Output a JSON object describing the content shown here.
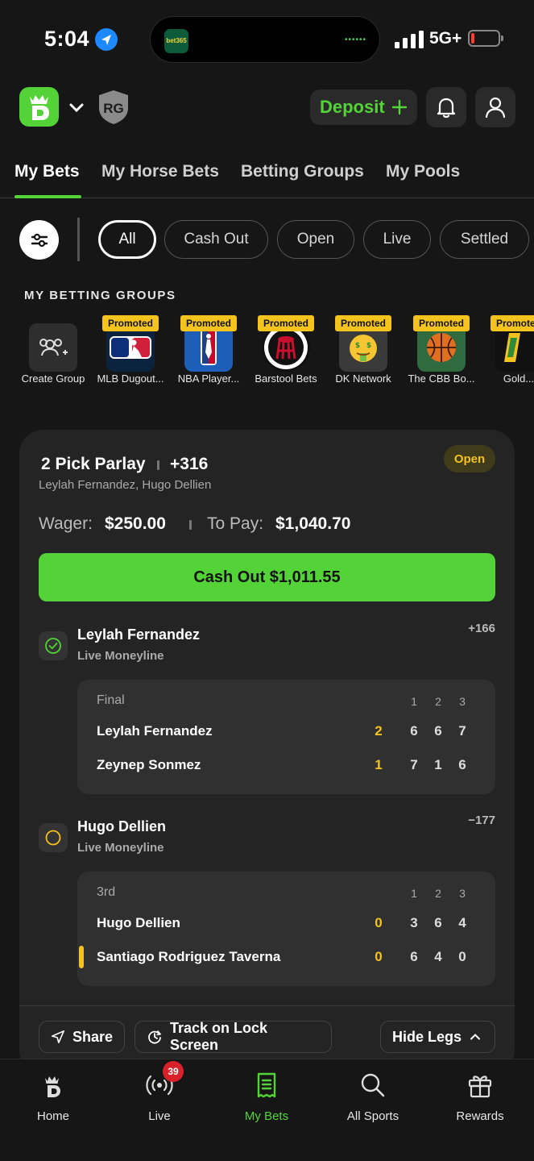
{
  "status_bar": {
    "time": "5:04",
    "network": "5G+",
    "island_app": "bet365",
    "battery_fraction": 0.12
  },
  "header": {
    "deposit_label": "Deposit",
    "rg_label": "RG"
  },
  "tabs": [
    {
      "label": "My Bets",
      "active": true
    },
    {
      "label": "My Horse Bets",
      "active": false
    },
    {
      "label": "Betting Groups",
      "active": false
    },
    {
      "label": "My Pools",
      "active": false
    }
  ],
  "filters": [
    {
      "label": "All",
      "active": true
    },
    {
      "label": "Cash Out",
      "active": false
    },
    {
      "label": "Open",
      "active": false
    },
    {
      "label": "Live",
      "active": false
    },
    {
      "label": "Settled",
      "active": false
    }
  ],
  "groups": {
    "title": "MY BETTING GROUPS",
    "promo_label": "Promoted",
    "items": [
      {
        "label": "Create Group",
        "icon": "create-group-icon",
        "promoted": false
      },
      {
        "label": "MLB Dugout...",
        "icon": "mlb-logo-icon",
        "promoted": true
      },
      {
        "label": "NBA Player...",
        "icon": "nba-logo-icon",
        "promoted": true
      },
      {
        "label": "Barstool Bets",
        "icon": "barstool-logo-icon",
        "promoted": true
      },
      {
        "label": "DK Network",
        "icon": "money-face-icon",
        "promoted": true
      },
      {
        "label": "The CBB Bo...",
        "icon": "basketball-icon",
        "promoted": true
      },
      {
        "label": "Gold...",
        "icon": "golf-logo-icon",
        "promoted": true
      }
    ]
  },
  "bet": {
    "title": "2 Pick Parlay",
    "odds": "+316",
    "subtitle": "Leylah Fernandez, Hugo Dellien",
    "status": "Open",
    "wager_label": "Wager:",
    "wager_value": "$250.00",
    "topay_label": "To Pay:",
    "topay_value": "$1,040.70",
    "cashout_label": "Cash Out $1,011.55",
    "legs": [
      {
        "selection": "Leylah Fernandez",
        "market": "Live Moneyline",
        "odds": "+166",
        "state": "won",
        "score": {
          "status": "Final",
          "headers": [
            "1",
            "2",
            "3"
          ],
          "players": [
            {
              "name": "Leylah Fernandez",
              "sets": "2",
              "games": [
                "6",
                "6",
                "7"
              ]
            },
            {
              "name": "Zeynep Sonmez",
              "sets": "1",
              "games": [
                "7",
                "1",
                "6"
              ]
            }
          ]
        }
      },
      {
        "selection": "Hugo Dellien",
        "market": "Live Moneyline",
        "odds": "−177",
        "state": "pending",
        "score": {
          "status": "3rd",
          "headers": [
            "1",
            "2",
            "3"
          ],
          "players": [
            {
              "name": "Hugo Dellien",
              "sets": "0",
              "games": [
                "3",
                "6",
                "4"
              ]
            },
            {
              "name": "Santiago Rodriguez Taverna",
              "sets": "0",
              "games": [
                "6",
                "4",
                "0"
              ]
            }
          ]
        }
      }
    ],
    "share_label": "Share",
    "track_label": "Track on Lock Screen",
    "hide_legs_label": "Hide Legs"
  },
  "bottom_nav": [
    {
      "label": "Home",
      "icon": "home-icon"
    },
    {
      "label": "Live",
      "icon": "live-icon",
      "badge": "39"
    },
    {
      "label": "My Bets",
      "icon": "my-bets-icon",
      "active": true
    },
    {
      "label": "All Sports",
      "icon": "search-icon"
    },
    {
      "label": "Rewards",
      "icon": "gift-icon"
    }
  ],
  "colors": {
    "accent": "#53d337",
    "gold": "#f5c31e",
    "background": "#161616",
    "card": "#242424"
  }
}
